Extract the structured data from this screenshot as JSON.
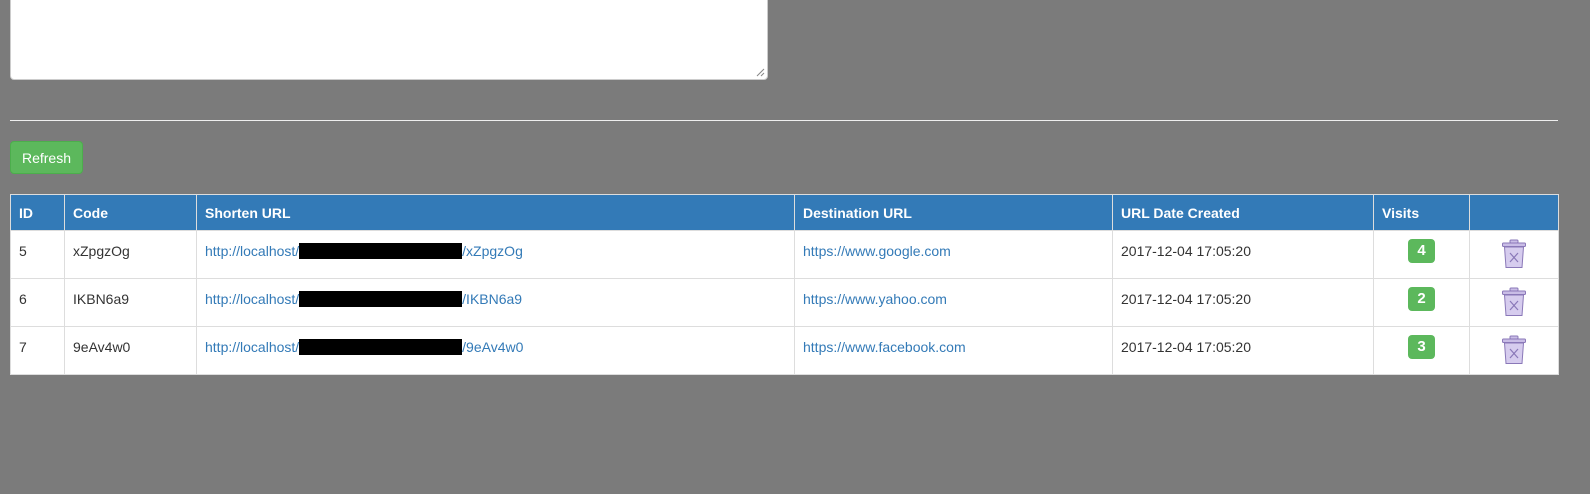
{
  "form": {
    "textarea_value": ""
  },
  "toolbar": {
    "refresh_label": "Refresh"
  },
  "table": {
    "headers": {
      "id": "ID",
      "code": "Code",
      "shorten_url": "Shorten URL",
      "destination_url": "Destination URL",
      "date_created": "URL Date Created",
      "visits": "Visits",
      "actions": ""
    },
    "rows": [
      {
        "id": "5",
        "code": "xZpgzOg",
        "short_prefix": "http://localhost/",
        "short_suffix": "/xZpgzOg",
        "destination": "https://www.google.com",
        "date": "2017-12-04 17:05:20",
        "visits": "4"
      },
      {
        "id": "6",
        "code": "IKBN6a9",
        "short_prefix": "http://localhost/",
        "short_suffix": "/IKBN6a9",
        "destination": "https://www.yahoo.com",
        "date": "2017-12-04 17:05:20",
        "visits": "2"
      },
      {
        "id": "7",
        "code": "9eAv4w0",
        "short_prefix": "http://localhost/",
        "short_suffix": "/9eAv4w0",
        "destination": "https://www.facebook.com",
        "date": "2017-12-04 17:05:20",
        "visits": "3"
      }
    ]
  },
  "colors": {
    "page_background": "#7b7b7b",
    "header_blue": "#337ab7",
    "success_green": "#5cb85c",
    "link_blue": "#337ab7",
    "trash_purple": "#9b87c9"
  },
  "icons": {
    "delete": "trash-icon",
    "resize": "resize-grip-icon"
  }
}
